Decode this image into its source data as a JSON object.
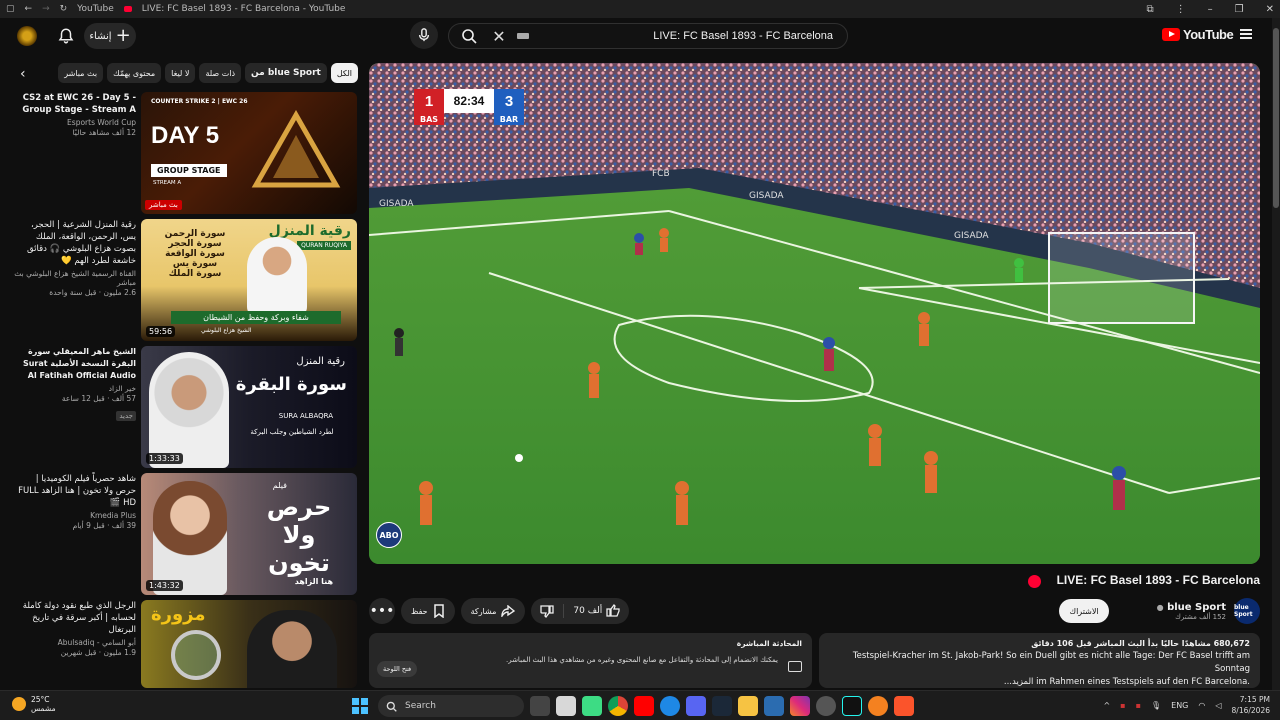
{
  "browser": {
    "tab_site": "YouTube",
    "tab_title": "LIVE: FC Basel 1893 - FC Barcelona - YouTube"
  },
  "header": {
    "create_label": "إنشاء",
    "search_value": "LIVE: FC Basel 1893 - FC Barcelona",
    "brand": "YouTube"
  },
  "chips": [
    {
      "label": "الكل",
      "active": true
    },
    {
      "label": "من blue Sport",
      "active": false
    },
    {
      "label": "ذات صلة",
      "active": false
    },
    {
      "label": "لا ليغا",
      "active": false
    },
    {
      "label": "محتوى يهمّك",
      "active": false
    },
    {
      "label": "بث مباشر",
      "active": false
    }
  ],
  "recommendations": [
    {
      "title": "CS2 at EWC 26 - Day 5 - Group Stage - Stream A",
      "channel": "Esports World Cup",
      "views": "12 ألف مشاهد حاليًا",
      "badge": "بث مباشر",
      "thumb_text": "DAY 5",
      "thumb_sub": "GROUP STAGE",
      "thumb_sub2": "STREAM A",
      "thumb_brand": "COUNTER STRIKE 2 | EWC 26"
    },
    {
      "title": "رقية المنزل الشرعية | الحجر، يس، الرحمن، الواقعة، الملك بصوت هزاع البلوشي 🎧 دقائق خاشعة لطرد الهم 💛",
      "channel": "القناة الرسمية الشيخ هزاع البلوشي بث مباشر",
      "views": "2.6 مليون · قبل سنة واحدة",
      "duration": "59:56",
      "thumb_text": "رقية المنزل",
      "thumb_sub": "QURAN RUQIYA",
      "thumb_lines": [
        "سورة الرحمن",
        "سورة الحجر",
        "سورة الواقعة",
        "سورة يس",
        "سورة الملك"
      ],
      "thumb_bar": "شفاء وبركة وحفظ من الشيطان",
      "thumb_name": "الشيخ هزاع البلوشي"
    },
    {
      "title": "الشيخ ماهر المعيقلي سورة البقرة النسخة الأصلية Surat Al Fatihah Official Audio",
      "channel": "خير الزاد",
      "views": "57 ألف · قبل 12 ساعة",
      "new": "جديد",
      "duration": "1:33:33",
      "thumb_text": "رقية المنزل",
      "thumb_big": "سورة البقرة",
      "thumb_sub": "SURA ALBAQRA",
      "thumb_caption": "لطرد الشياطين وجلب البركة"
    },
    {
      "title": "شاهد حصرياً فيلم الكوميديا | حرص ولا تخون | هنا الزاهد FULL HD 🎬",
      "channel": "Kmedia Plus",
      "views": "39 ألف · قبل 9 أيام",
      "duration": "1:43:32",
      "thumb_small": "فيلم",
      "thumb_big": "حرص ولا تخون",
      "thumb_name": "هنا الزاهد"
    },
    {
      "title": "الرجل الذي طبع نقود دولة كاملة لحسابه | أكبر سرقة في تاريخ البرتغال",
      "channel": "أبو السامي - Abulsadiq",
      "views": "1.9 مليون · قبل شهرين",
      "thumb_big": "مزورة"
    }
  ],
  "player": {
    "home_score": "1",
    "home_abbr": "BAS",
    "clock": "82:34",
    "away_score": "3",
    "away_abbr": "BAR",
    "broadcaster": "ABO",
    "ad_boards": [
      "GISADA",
      "GISADA",
      "GISADA",
      "FCB"
    ]
  },
  "video": {
    "title": "LIVE: FC Basel 1893 - FC Barcelona",
    "likes": "70 ألف",
    "share_label": "مشاركة",
    "save_label": "حفظ",
    "channel_name": "blue Sport",
    "channel_avatar_text": "blue Sport",
    "subscribers": "152 ألف مشترك",
    "subscribe_label": "الاشتراك",
    "description_stats": "680,672 مشاهدًا حاليًا  بدأ البث المباشر قبل 106 دقائق",
    "description_line1": "Testspiel-Kracher im St. Jakob-Park! So ein Duell gibt es nicht alle Tage: Der FC Basel trifft am Sonntag",
    "description_line2": "...المزيد   im Rahmen eines Testspiels auf den FC Barcelona."
  },
  "chat": {
    "heading": "المحادثة المباشرة",
    "body": "يمكنك الانضمام إلى المحادثة والتفاعل مع صانع المحتوى وغيره من مشاهدي هذا البث المباشر.",
    "open_label": "فتح اللوحة"
  },
  "taskbar": {
    "temp": "25°C",
    "condition": "مشمس",
    "search_label": "Search",
    "lang": "ENG",
    "time": "7:15 PM",
    "date": "8/16/2026"
  },
  "colors": {
    "background": "#0f0f0f",
    "chip": "#272727",
    "brand_red": "#ff0000",
    "live_red": "#ff0033",
    "home_team": "#d12026",
    "away_team": "#1f5fbf",
    "pitch": "#3f8f38"
  },
  "icons": [
    "back-icon",
    "forward-icon",
    "refresh-icon",
    "bell-icon",
    "plus-icon",
    "mic-icon",
    "search-icon",
    "clear-icon",
    "keyboard-icon",
    "menu-icon",
    "chevron-left-icon",
    "more-icon",
    "save-icon",
    "share-icon",
    "dislike-icon",
    "like-icon",
    "verified-icon",
    "chat-icon",
    "windows-start-icon"
  ]
}
